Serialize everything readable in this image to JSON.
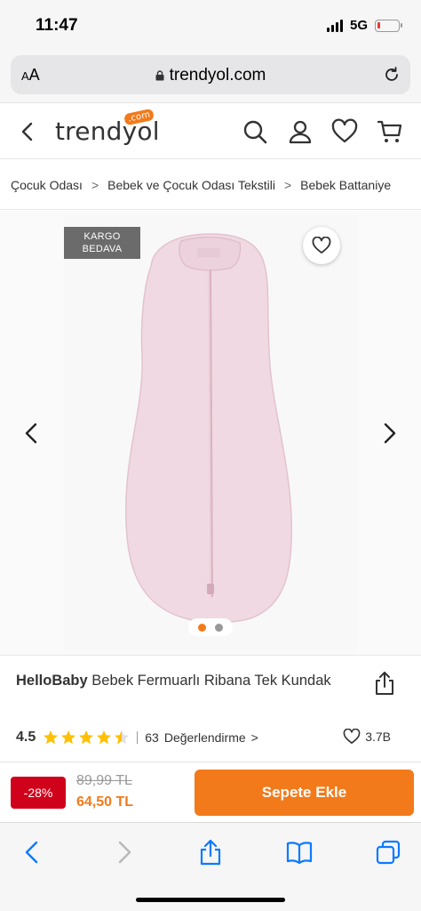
{
  "status_bar": {
    "time": "11:47",
    "network": "5G",
    "battery_level": 0.15
  },
  "browser": {
    "text_size_label": "AA",
    "url": "trendyol.com",
    "lock_icon": "lock-icon",
    "reload_icon": "reload-icon"
  },
  "header": {
    "logo_text": "trendyol",
    "logo_badge": ".com",
    "icons": [
      "back-icon",
      "search-icon",
      "user-icon",
      "heart-icon",
      "cart-icon"
    ]
  },
  "breadcrumb": {
    "items": [
      "Çocuk Odası",
      "Bebek ve Çocuk Odası Tekstili",
      "Bebek Battaniye"
    ],
    "separator": ">"
  },
  "gallery": {
    "badge_line1": "KARGO",
    "badge_line2": "BEDAVA",
    "image_count": 2,
    "active_index": 0,
    "accent_color": "#f27a1a",
    "product_color": "#f0d9e2"
  },
  "product": {
    "brand": "HelloBaby",
    "name": "Bebek Fermuarlı Ribana Tek Kundak",
    "rating": "4.5",
    "rating_value": 4.5,
    "review_count": "63",
    "review_label": "Değerlendirme",
    "review_chevron": ">",
    "favorite_count": "3.7B"
  },
  "price": {
    "discount": "-28%",
    "old_price": "89,99 TL",
    "new_price": "64,50 TL",
    "discount_color": "#d0021b"
  },
  "actions": {
    "add_to_cart": "Sepete Ekle",
    "button_color": "#f27a1a"
  },
  "toolbar": {
    "icons": [
      "back-arrow-icon",
      "forward-arrow-icon",
      "share-icon",
      "bookmarks-icon",
      "tabs-icon"
    ]
  }
}
